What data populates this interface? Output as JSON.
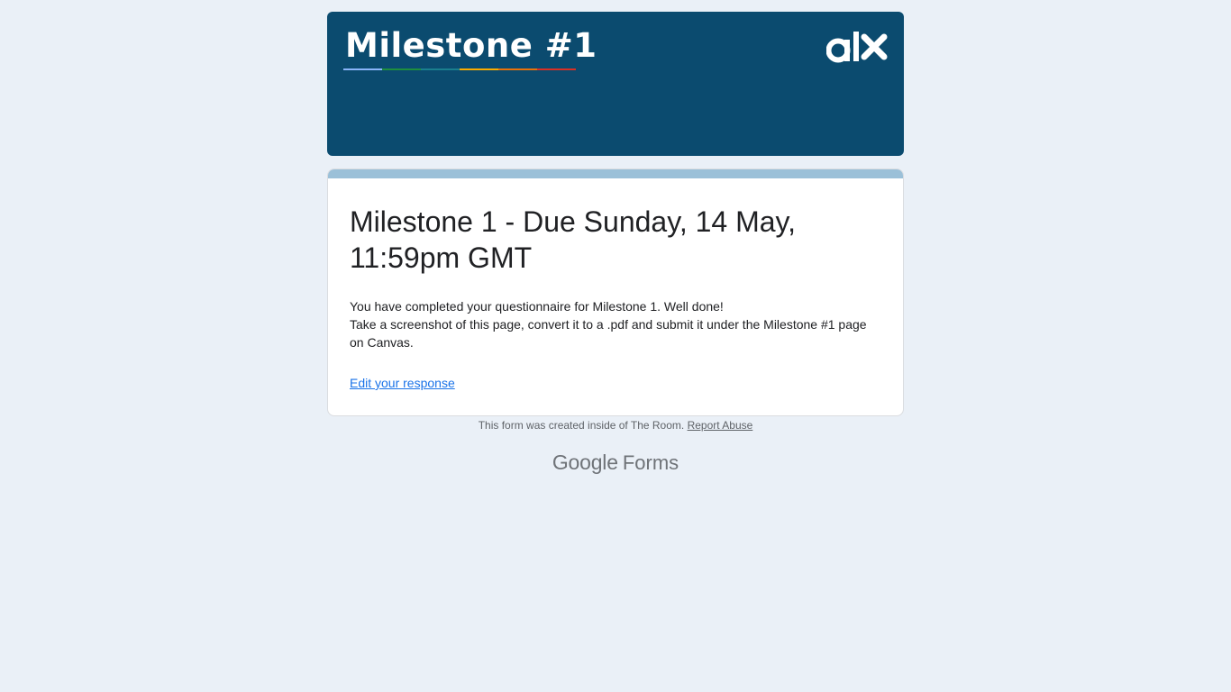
{
  "banner": {
    "title": "Milestone #1",
    "logo_icon": "alx-logo",
    "background_color": "#0b4b6f",
    "underline_colors": [
      "#8ab4f8",
      "#1e8e3e",
      "#1a7f8e",
      "#f9ab00",
      "#e8710a",
      "#d93025"
    ]
  },
  "card": {
    "accent_color": "#9bc0d8",
    "title": "Milestone 1 - Due Sunday, 14 May, 11:59pm GMT",
    "message_line1": "You have completed your questionnaire for Milestone 1. Well done!",
    "message_line2": "Take a screenshot of this page, convert it to a .pdf and submit it under the Milestone #1 page on Canvas.",
    "edit_link": "Edit your response"
  },
  "footer": {
    "note": "This form was created inside of The Room.",
    "report_link": "Report Abuse",
    "brand_google": "Google",
    "brand_forms": "Forms"
  }
}
